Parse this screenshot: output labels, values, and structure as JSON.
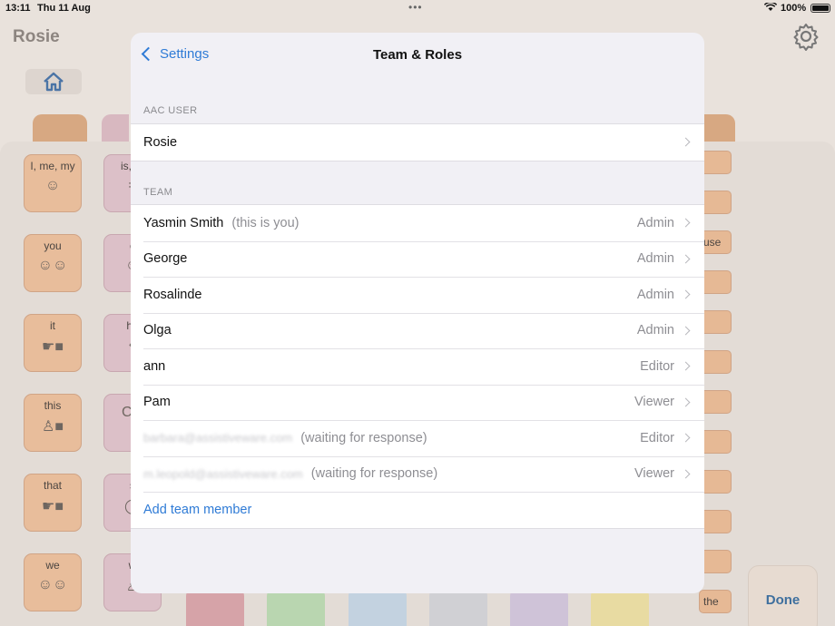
{
  "status_bar": {
    "time": "13:11",
    "date": "Thu 11 Aug",
    "multitask_dots": "•••",
    "battery": "100%"
  },
  "background_app": {
    "title": "Rosie",
    "done_label": "Done",
    "cells": [
      {
        "label": "I, me, my",
        "glyph": "☺"
      },
      {
        "label": "you",
        "glyph": "☺☺"
      },
      {
        "label": "it",
        "glyph": "☛■"
      },
      {
        "label": "this",
        "glyph": "♙■"
      },
      {
        "label": "that",
        "glyph": "☛■"
      },
      {
        "label": "we",
        "glyph": "☺☺"
      }
    ],
    "partial_cells": [
      {
        "label": "is, ar",
        "glyph": "="
      },
      {
        "label": "c",
        "glyph": "☺"
      },
      {
        "label": "ho",
        "glyph": "♦"
      },
      {
        "label": "",
        "glyph": "CO"
      },
      {
        "label": "s",
        "glyph": "◯"
      },
      {
        "label": "w",
        "glyph": "♙"
      }
    ],
    "right_column": [
      "",
      "",
      "use",
      "",
      "",
      "",
      "",
      "",
      "",
      "",
      "",
      "the"
    ]
  },
  "modal": {
    "back_label": "Settings",
    "title": "Team & Roles",
    "aac_section_header": "AAC USER",
    "aac_user": "Rosie",
    "team_section_header": "TEAM",
    "members": [
      {
        "name": "Yasmin Smith",
        "note": "(this is you)",
        "role": "Admin",
        "pending": false
      },
      {
        "name": "George",
        "note": "",
        "role": "Admin",
        "pending": false
      },
      {
        "name": "Rosalinde",
        "note": "",
        "role": "Admin",
        "pending": false
      },
      {
        "name": "Olga",
        "note": "",
        "role": "Admin",
        "pending": false
      },
      {
        "name": "ann",
        "note": "",
        "role": "Editor",
        "pending": false
      },
      {
        "name": "Pam",
        "note": "",
        "role": "Viewer",
        "pending": false
      },
      {
        "name": "barbara@assistiveware.com",
        "note": "(waiting for response)",
        "role": "Editor",
        "pending": true
      },
      {
        "name": "m.leopold@assistiveware.com",
        "note": "(waiting for response)",
        "role": "Viewer",
        "pending": true
      }
    ],
    "add_member_label": "Add team member"
  },
  "colors": {
    "accent": "#2f7bd6",
    "secondary_text": "#8e8e93",
    "modal_background": "#f1f0f5"
  }
}
